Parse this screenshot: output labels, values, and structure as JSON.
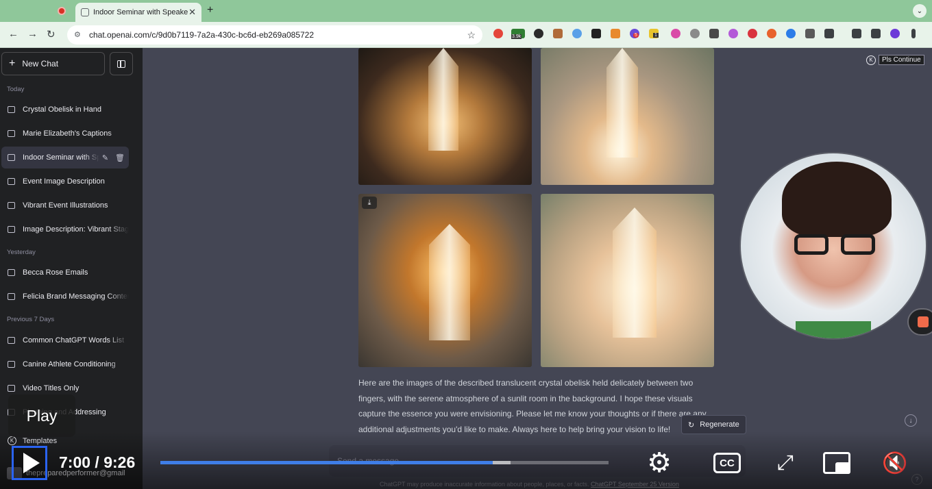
{
  "browser": {
    "tab_title": "Indoor Seminar with Speaker",
    "url": "chat.openai.com/c/9d0b7119-7a2a-430c-bc6d-eb269a085722",
    "extension_badges": [
      "3.9k",
      "5",
      "1"
    ]
  },
  "sidebar": {
    "new_chat": "New Chat",
    "sections": {
      "today": "Today",
      "yesterday": "Yesterday",
      "previous7": "Previous 7 Days"
    },
    "today_items": [
      "Crystal Obelisk in Hand",
      "Marie Elizabeth's Captions",
      "Indoor Seminar with Speaker",
      "Event Image Description",
      "Vibrant Event Illustrations",
      "Image Description: Vibrant Stage"
    ],
    "yesterday_items": [
      "Becca Rose Emails",
      "Felicia Brand Messaging Content"
    ],
    "previous_items": [
      "Common ChatGPT Words List",
      "Canine Athlete Conditioning",
      "Video Titles Only",
      "Planning and Addressing"
    ],
    "templates": "Templates",
    "user": "thepreparedperformer@gmail"
  },
  "main": {
    "pls_continue": "Pls Continue",
    "reply_text": "Here are the images of the described translucent crystal obelisk held delicately between two fingers, with the serene atmosphere of a sunlit room in the background. I hope these visuals capture the essence you were envisioning. Please let me know your thoughts or if there are any additional adjustments you'd like to make. Always here to help bring your vision to life!",
    "regenerate": "Regenerate",
    "composer_placeholder": "Send a message",
    "disclaimer": "ChatGPT may produce inaccurate information about people, places, or facts.",
    "disclaimer_link": "ChatGPT September 25 Version",
    "help": "?"
  },
  "player": {
    "play_tooltip": "Play",
    "current_time": "7:00",
    "duration": "9:26",
    "time_separator": " / ",
    "played_fraction": 0.7414,
    "buffered_fraction": 0.7813,
    "cc_label": "CC"
  }
}
